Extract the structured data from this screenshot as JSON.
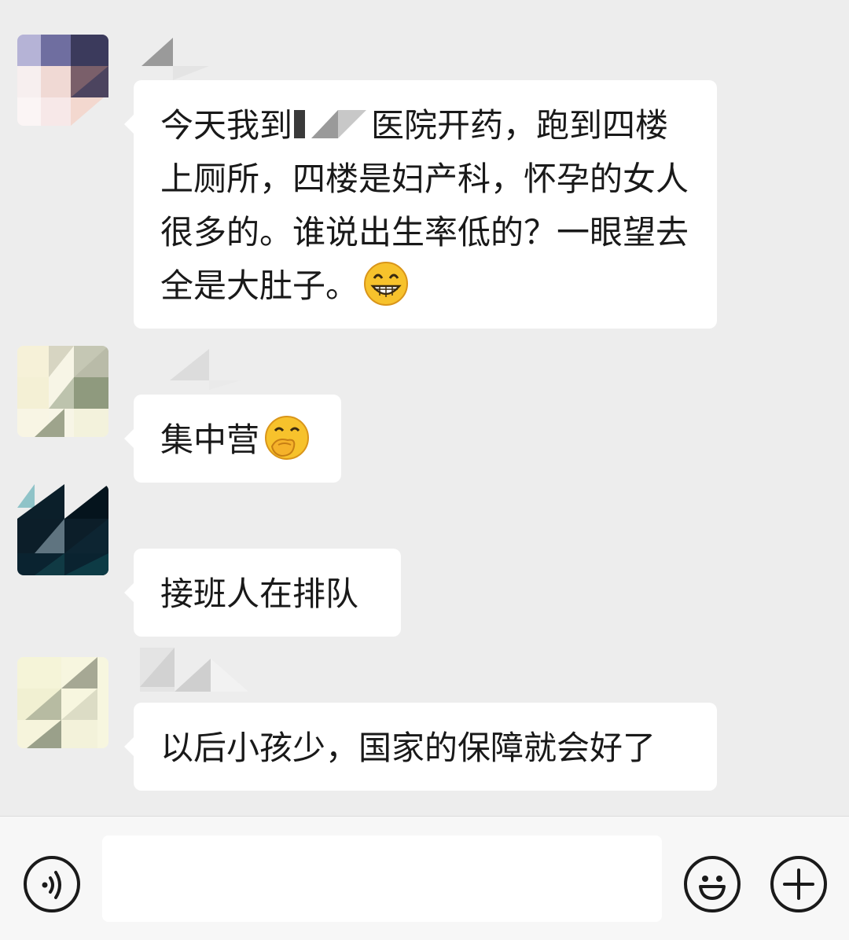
{
  "messages": [
    {
      "sender": "",
      "text_before": "今天我到",
      "text_after": "医院开药，跑到四楼上厕所，四楼是妇产科，怀孕的女人很多的。谁说出生率低的？一眼望去全是大肚子。",
      "emoji": "grinning-face-emoji"
    },
    {
      "sender": "",
      "text": "集中营",
      "emoji": "face-with-hand-over-mouth-emoji"
    },
    {
      "sender": "",
      "text": "接班人在排队"
    },
    {
      "sender": "",
      "text": "以后小孩少，国家的保障就会好了"
    }
  ],
  "input_bar": {
    "input_value": "",
    "voice_icon": "voice-icon",
    "emoji_icon": "smiley-icon",
    "plus_icon": "plus-icon"
  }
}
